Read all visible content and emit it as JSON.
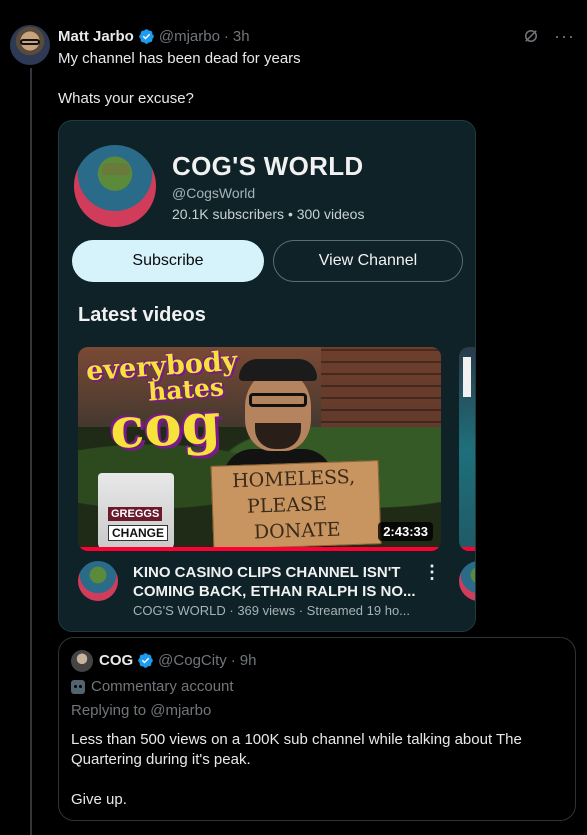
{
  "post": {
    "author_name": "Matt Jarbo",
    "author_handle": "@mjarbo",
    "separator": "·",
    "time": "3h",
    "more_label": "···",
    "text_line1": "My channel has been dead for years",
    "text_line2": "Whats your excuse?"
  },
  "channel_card": {
    "title": "COG'S WORLD",
    "handle": "@CogsWorld",
    "stats": "20.1K subscribers • 300 videos",
    "subscribe_label": "Subscribe",
    "view_channel_label": "View Channel",
    "section_title": "Latest videos",
    "video": {
      "thumb_text_1": "everybody",
      "thumb_text_2": "hates",
      "thumb_text_3": "cog",
      "sign_line_1": "HOMELESS,",
      "sign_line_2": "PLEASE",
      "sign_line_3": "DONATE",
      "cup_label_1": "GREGGS",
      "cup_label_2": "CHANGE",
      "duration": "2:43:33",
      "watched_fraction": 1.0,
      "title_line1": "KINO CASINO CLIPS CHANNEL ISN'T",
      "title_line2": "COMING BACK, ETHAN RALPH IS NO...",
      "meta": "COG'S WORLD · 369 views · Streamed 19 ho..."
    },
    "colors": {
      "card_bg": "#0e2228",
      "subscribe_bg": "#d6f3fb",
      "progress": "#ff0033"
    }
  },
  "quote": {
    "author_name": "COG",
    "author_handle": "@CogCity",
    "separator": "·",
    "time": "9h",
    "affiliation": "Commentary account",
    "replying_prefix": "Replying to",
    "replying_handle": "@mjarbo",
    "body_line1": "Less than 500 views on a 100K sub channel while talking about The Quartering during it's peak.",
    "body_line2": "Give up."
  },
  "colors": {
    "accent_verified": "#1d9bf0",
    "muted": "#71767b",
    "text": "#e7e9ea",
    "bg": "#000000"
  }
}
